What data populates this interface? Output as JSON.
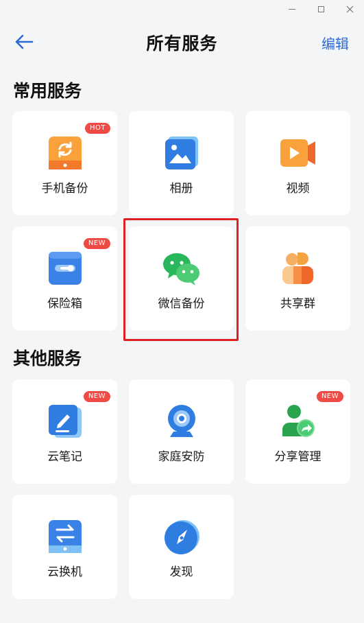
{
  "header": {
    "title": "所有服务",
    "edit_label": "编辑"
  },
  "sections": {
    "common": {
      "title": "常用服务",
      "items": [
        {
          "label": "手机备份",
          "badge": "HOT",
          "icon": "phone-backup-icon"
        },
        {
          "label": "相册",
          "icon": "album-icon"
        },
        {
          "label": "视频",
          "icon": "video-icon"
        },
        {
          "label": "保险箱",
          "badge": "NEW",
          "icon": "safe-box-icon"
        },
        {
          "label": "微信备份",
          "icon": "wechat-icon"
        },
        {
          "label": "共享群",
          "icon": "share-group-icon"
        }
      ]
    },
    "other": {
      "title": "其他服务",
      "items": [
        {
          "label": "云笔记",
          "badge": "NEW",
          "icon": "cloud-note-icon"
        },
        {
          "label": "家庭安防",
          "icon": "home-security-camera-icon"
        },
        {
          "label": "分享管理",
          "badge": "NEW",
          "icon": "share-manage-icon"
        },
        {
          "label": "云换机",
          "icon": "cloud-switch-phone-icon"
        },
        {
          "label": "发现",
          "icon": "compass-icon"
        }
      ]
    }
  },
  "colors": {
    "accent": "#2d6ad8",
    "badge": "#ef4a43",
    "highlight": "#e02020"
  }
}
